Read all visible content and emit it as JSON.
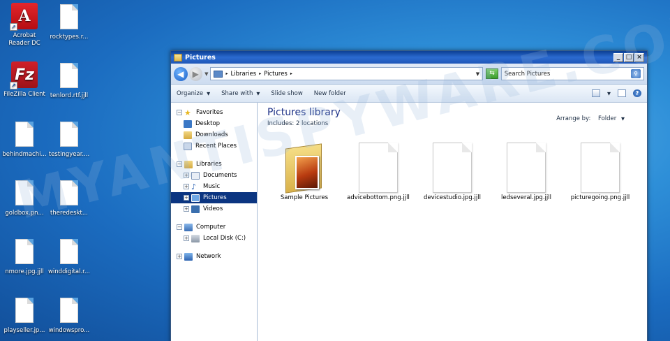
{
  "desktop": {
    "icons": [
      {
        "label": "Acrobat\nReader DC",
        "kind": "acrobat"
      },
      {
        "label": "rocktypes.r...",
        "kind": "doc"
      },
      {
        "label": "FileZilla Client",
        "kind": "filezilla"
      },
      {
        "label": "tenlord.rtf.jjll",
        "kind": "doc"
      },
      {
        "label": "behindmachi...",
        "kind": "doc"
      },
      {
        "label": "testingyear....",
        "kind": "doc"
      },
      {
        "label": "goldbox.pn...",
        "kind": "doc"
      },
      {
        "label": "theredeskt...",
        "kind": "doc"
      },
      {
        "label": "nmore.jpg.jjll",
        "kind": "doc"
      },
      {
        "label": "winddigital.r...",
        "kind": "doc"
      },
      {
        "label": "playseller.jp...",
        "kind": "doc"
      },
      {
        "label": "windowspro...",
        "kind": "doc"
      }
    ],
    "watermark": "MYANTISPYWARE.COM"
  },
  "window": {
    "title": "Pictures",
    "address": {
      "crumb1": "Libraries",
      "crumb2": "Pictures"
    },
    "search_placeholder": "Search Pictures",
    "toolbar": {
      "organize": "Organize",
      "share": "Share with",
      "slideshow": "Slide show",
      "newfolder": "New folder"
    },
    "nav": {
      "favorites": "Favorites",
      "desktop": "Desktop",
      "downloads": "Downloads",
      "recent": "Recent Places",
      "libraries": "Libraries",
      "documents": "Documents",
      "music": "Music",
      "pictures": "Pictures",
      "videos": "Videos",
      "computer": "Computer",
      "localdisk": "Local Disk (C:)",
      "network": "Network"
    },
    "content": {
      "title": "Pictures library",
      "includes_label": "Includes:",
      "includes_value": "2 locations",
      "arrange_label": "Arrange by:",
      "arrange_value": "Folder",
      "files": [
        {
          "name": "Sample Pictures",
          "type": "folder"
        },
        {
          "name": "advicebottom.png.jjll",
          "type": "file"
        },
        {
          "name": "devicestudio.jpg.jjll",
          "type": "file"
        },
        {
          "name": "ledseveral.jpg.jjll",
          "type": "file"
        },
        {
          "name": "picturegoing.png.jjll",
          "type": "file"
        }
      ]
    }
  }
}
